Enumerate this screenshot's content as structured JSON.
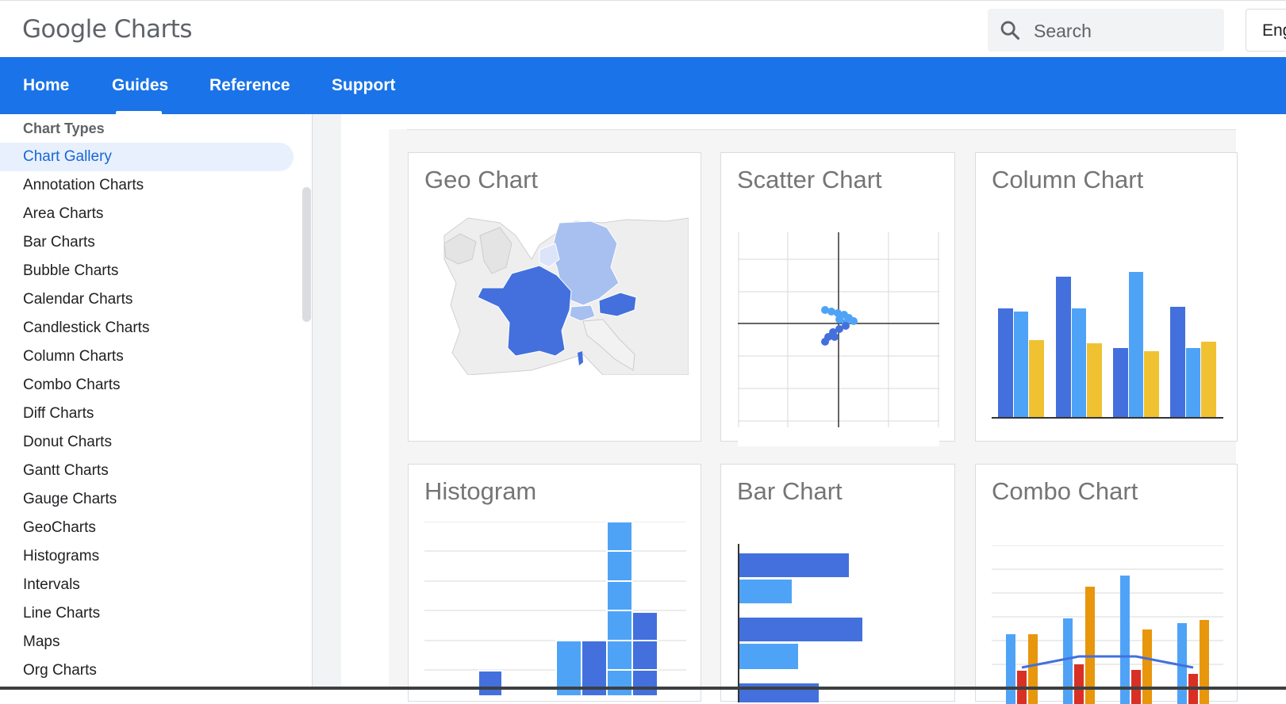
{
  "header": {
    "logo_text": "Google Charts",
    "search_placeholder": "Search",
    "language_label": "Eng"
  },
  "nav": {
    "tabs": [
      {
        "label": "Home",
        "active": false
      },
      {
        "label": "Guides",
        "active": true
      },
      {
        "label": "Reference",
        "active": false
      },
      {
        "label": "Support",
        "active": false
      }
    ]
  },
  "sidebar": {
    "heading": "Chart Types",
    "items": [
      {
        "label": "Chart Gallery",
        "active": true
      },
      {
        "label": "Annotation Charts"
      },
      {
        "label": "Area Charts"
      },
      {
        "label": "Bar Charts"
      },
      {
        "label": "Bubble Charts"
      },
      {
        "label": "Calendar Charts"
      },
      {
        "label": "Candlestick Charts"
      },
      {
        "label": "Column Charts"
      },
      {
        "label": "Combo Charts"
      },
      {
        "label": "Diff Charts"
      },
      {
        "label": "Donut Charts"
      },
      {
        "label": "Gantt Charts"
      },
      {
        "label": "Gauge Charts"
      },
      {
        "label": "GeoCharts"
      },
      {
        "label": "Histograms"
      },
      {
        "label": "Intervals"
      },
      {
        "label": "Line Charts"
      },
      {
        "label": "Maps"
      },
      {
        "label": "Org Charts"
      }
    ]
  },
  "gallery": {
    "cards": [
      {
        "title": "Geo Chart",
        "icon": "geo-chart-thumbnail"
      },
      {
        "title": "Scatter Chart",
        "icon": "scatter-chart-thumbnail"
      },
      {
        "title": "Column Chart",
        "icon": "column-chart-thumbnail"
      },
      {
        "title": "Histogram",
        "icon": "histogram-thumbnail"
      },
      {
        "title": "Bar Chart",
        "icon": "bar-chart-thumbnail"
      },
      {
        "title": "Combo Chart",
        "icon": "combo-chart-thumbnail"
      }
    ]
  },
  "colors": {
    "brand_blue": "#1a73e8",
    "series_dark_blue": "#4370dd",
    "series_light_blue": "#4fa3f7",
    "series_yellow": "#f0c232",
    "series_orange": "#e8960c",
    "series_red": "#d93025"
  }
}
